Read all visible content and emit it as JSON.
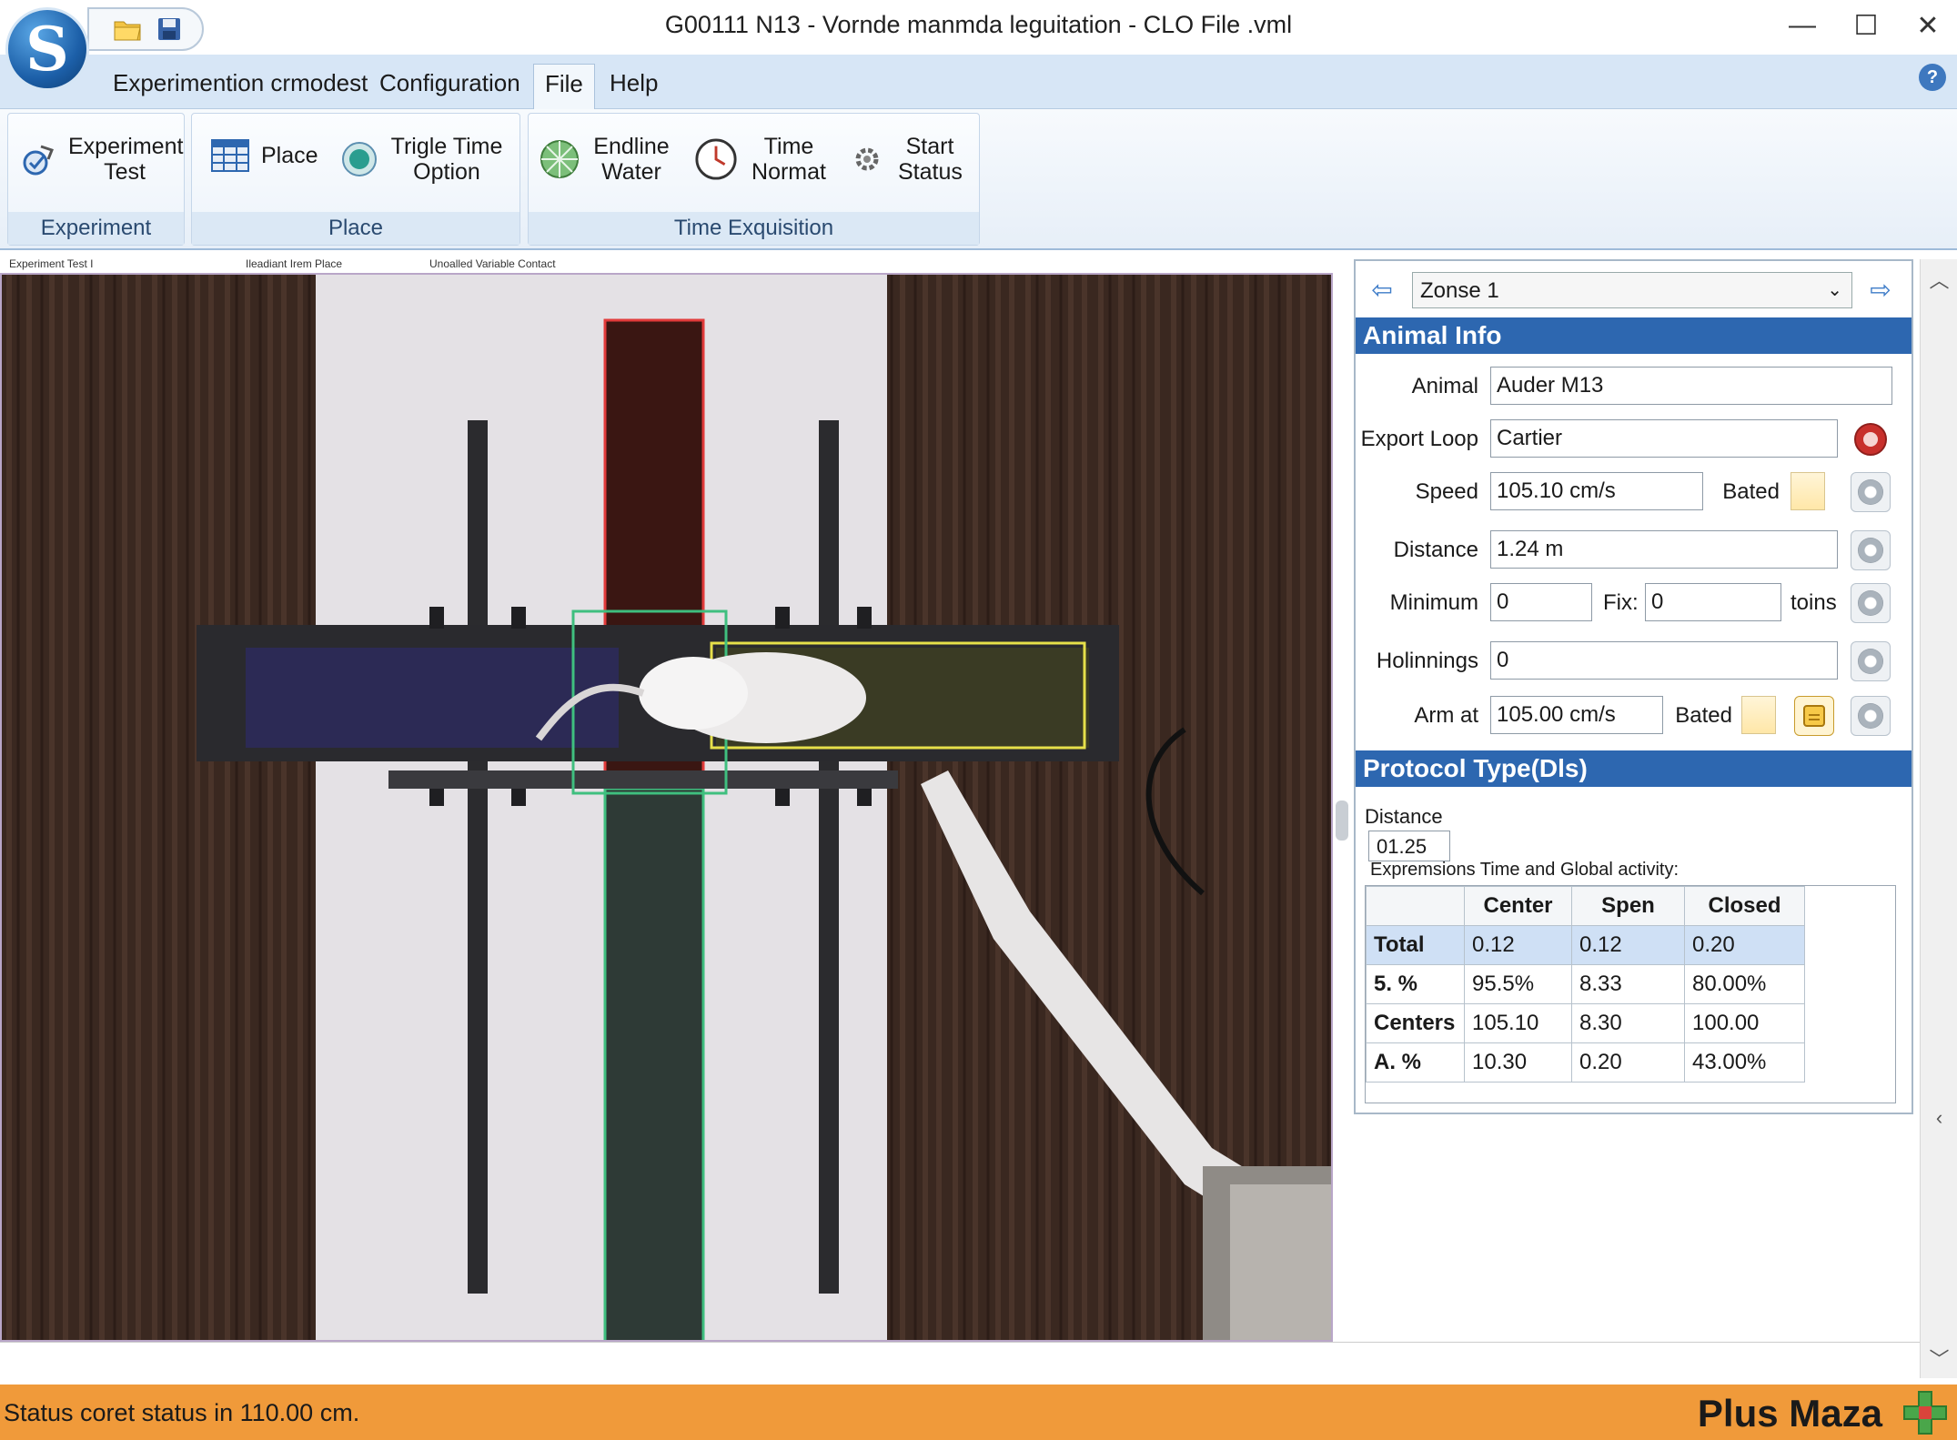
{
  "window": {
    "title": "G00111 N13 - Vornde manmda leguitation - CLO File .vml",
    "minimize": "—",
    "maximize": "☐",
    "close": "✕"
  },
  "app_logo": "S",
  "menu": {
    "items": [
      "Experimention crmodest",
      "Configuration",
      "File",
      "Help"
    ],
    "active": "File"
  },
  "ribbon": {
    "groups": [
      {
        "label": "Experiment",
        "buttons": [
          {
            "label": "Experiment Test",
            "icon": "experiment-icon"
          }
        ]
      },
      {
        "label": "Place",
        "buttons": [
          {
            "label": "Place",
            "icon": "table-icon"
          },
          {
            "label": "Trigle Time Option",
            "icon": "circle-icon"
          }
        ]
      },
      {
        "label": "Time Exquisition",
        "buttons": [
          {
            "label": "Endline Water",
            "icon": "globe-icon"
          },
          {
            "label": "Time Normat",
            "icon": "clock-icon"
          },
          {
            "label": "Start Status",
            "icon": "gear-icon"
          }
        ]
      }
    ]
  },
  "video_header": [
    "Experiment Test I",
    "Ileadiant Irem Place",
    "Unoalled Variable Contact"
  ],
  "right_panel": {
    "zone": "Zonse 1",
    "animal_info_title": "Animal Info",
    "fields": {
      "animal": {
        "label": "Animal",
        "value": "Auder M13"
      },
      "export_loop": {
        "label": "Export Loop",
        "value": "Cartier"
      },
      "speed": {
        "label": "Speed",
        "value": "105.10 cm/s",
        "extra_label": "Bated"
      },
      "distance": {
        "label": "Distance",
        "value": "1.24 m"
      },
      "minimum": {
        "label": "Minimum",
        "value": "0",
        "fix_label": "Fix:",
        "fix_value": "0",
        "unit": "toins"
      },
      "holinnings": {
        "label": "Holinnings",
        "value": "0"
      },
      "arm_at": {
        "label": "Arm at",
        "value": "105.00 cm/s",
        "extra_label": "Bated"
      }
    },
    "protocol_title": "Protocol Type(Dls)",
    "distance_label": "Distance",
    "distance_value": "01.25",
    "expressions_label": "Expremsions Time and Global activity:",
    "table": {
      "columns": [
        "",
        "Center",
        "Spen",
        "Closed"
      ],
      "rows": [
        [
          "Total",
          "0.12",
          "0.12",
          "0.20"
        ],
        [
          "5. %",
          "95.5%",
          "8.33",
          "80.00%"
        ],
        [
          "Centers",
          "105.10",
          "8.30",
          "100.00"
        ],
        [
          "A. %",
          "10.30",
          "0.20",
          "43.00%"
        ]
      ]
    }
  },
  "status": {
    "text": "Status coret status in 110.00 cm.",
    "brand": "Plus Maza"
  },
  "colors": {
    "accent": "#2d67b0",
    "status_bar": "#f09a3a",
    "zone_open": "#e23b3b",
    "zone_center": "#3fbf7f",
    "zone_closed": "#e6e04a"
  }
}
